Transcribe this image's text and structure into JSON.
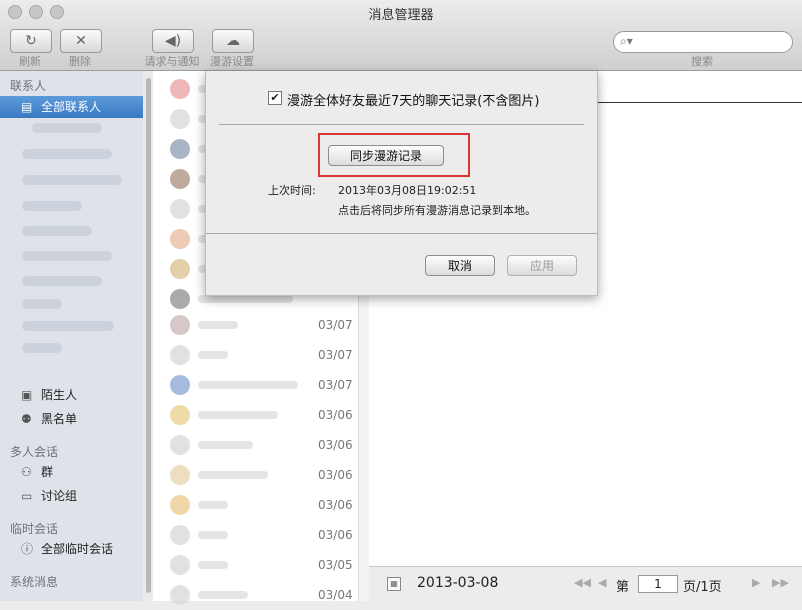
{
  "window": {
    "title": "消息管理器"
  },
  "toolbar": {
    "refresh_label": "刷新",
    "delete_label": "删除",
    "notify_label": "请求与通知",
    "roaming_label": "漫游设置",
    "search_label": "搜索",
    "search_placeholder": ""
  },
  "sidebar": {
    "contacts_header": "联系人",
    "all_contacts": "全部联系人",
    "stranger": "陌生人",
    "blacklist": "黑名单",
    "multi_header": "多人会话",
    "group": "群",
    "discussion": "讨论组",
    "temp_header": "临时会话",
    "all_temp": "全部临时会话",
    "system_header": "系统消息"
  },
  "list": {
    "dates": [
      "03/07",
      "03/07",
      "03/07",
      "03/06",
      "03/06",
      "03/06",
      "03/06",
      "03/06",
      "03/05",
      "03/04"
    ]
  },
  "bottom": {
    "date": "2013-03-08",
    "page_prefix": "第",
    "page_value": "1",
    "page_suffix": "页/1页"
  },
  "dialog": {
    "checkbox_label": "漫游全体好友最近7天的聊天记录(不含图片)",
    "checkbox_checked": true,
    "sync_button": "同步漫游记录",
    "last_time_label": "上次时间:",
    "last_time_value": "2013年03月08日19:02:51",
    "hint": "点击后将同步所有漫游消息记录到本地。",
    "cancel_button": "取消",
    "apply_button": "应用"
  },
  "colors": {
    "selection": "#3a78c3",
    "highlight_box": "#d93636"
  }
}
